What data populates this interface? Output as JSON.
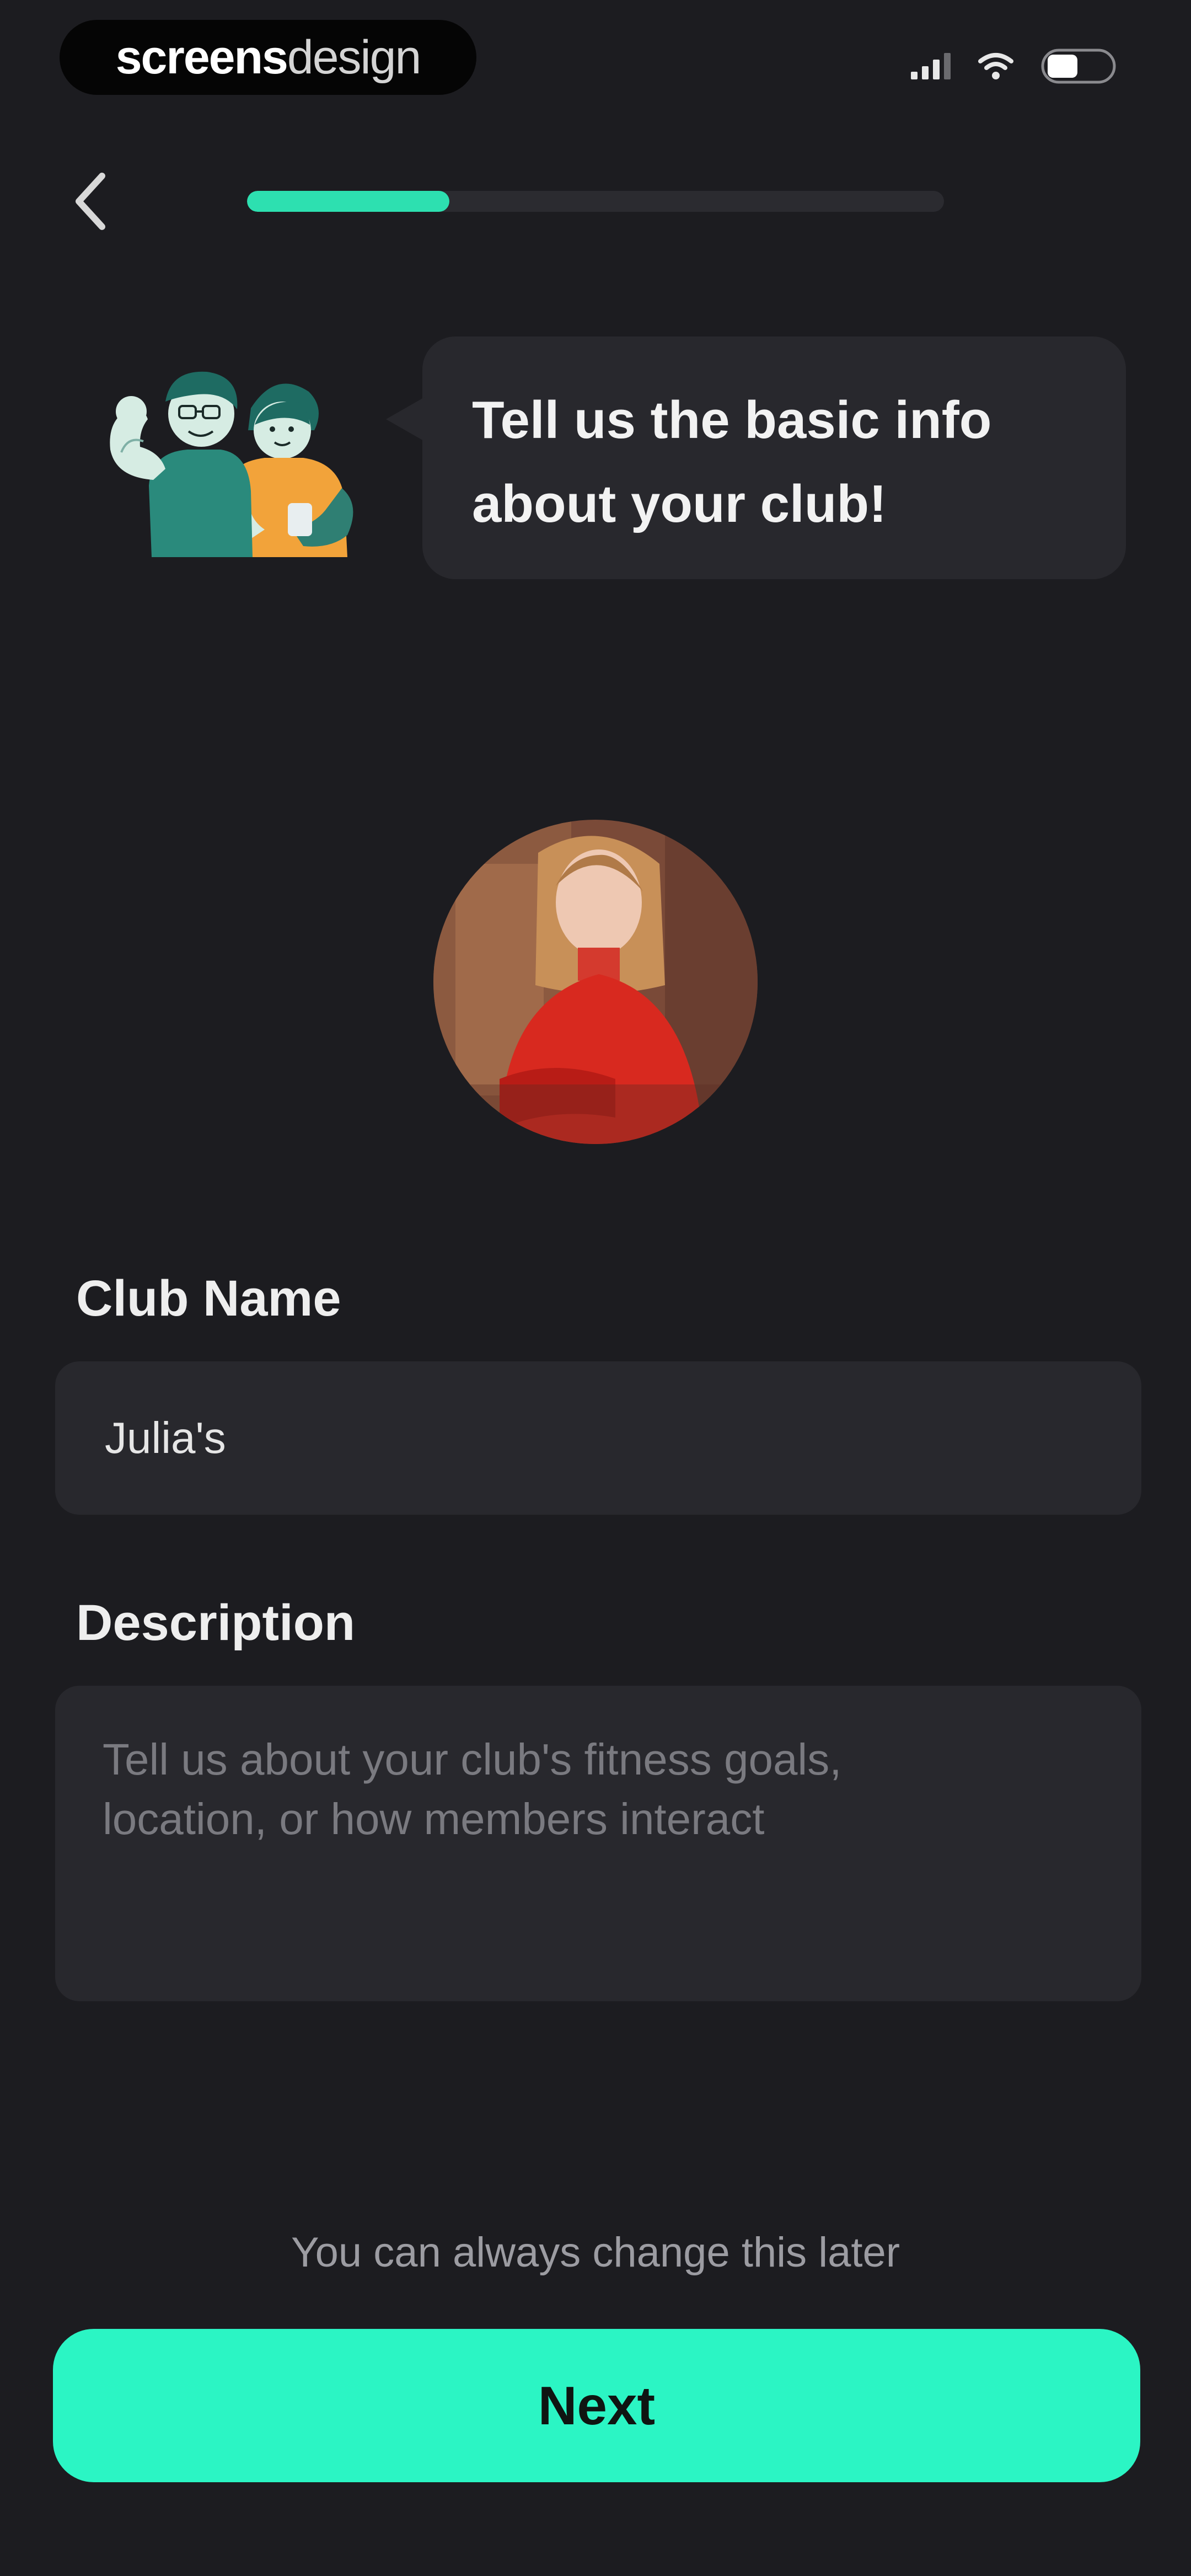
{
  "status_bar": {
    "brand_bold": "screens",
    "brand_light": "design",
    "icons": [
      "signal-icon",
      "wifi-icon",
      "toggle-icon"
    ]
  },
  "nav": {
    "back_icon": "chevron-left-icon",
    "progress_fraction": 0.29
  },
  "header": {
    "mascot_icon": "flexing-friends-illustration",
    "speech_line1": "Tell us the basic info",
    "speech_line2": "about your club!"
  },
  "avatar": {
    "icon": "club-photo-avatar"
  },
  "form": {
    "club_name_label": "Club Name",
    "club_name_value": "Julia's",
    "description_label": "Description",
    "description_placeholder": "Tell us about your club's fitness goals,\nlocation, or how members interact"
  },
  "footer": {
    "hint": "You can always change this later",
    "next_label": "Next"
  },
  "colors": {
    "background": "#1c1c20",
    "surface": "#28282d",
    "accent": "#2bf5c4",
    "progress": "#2de0b0"
  }
}
